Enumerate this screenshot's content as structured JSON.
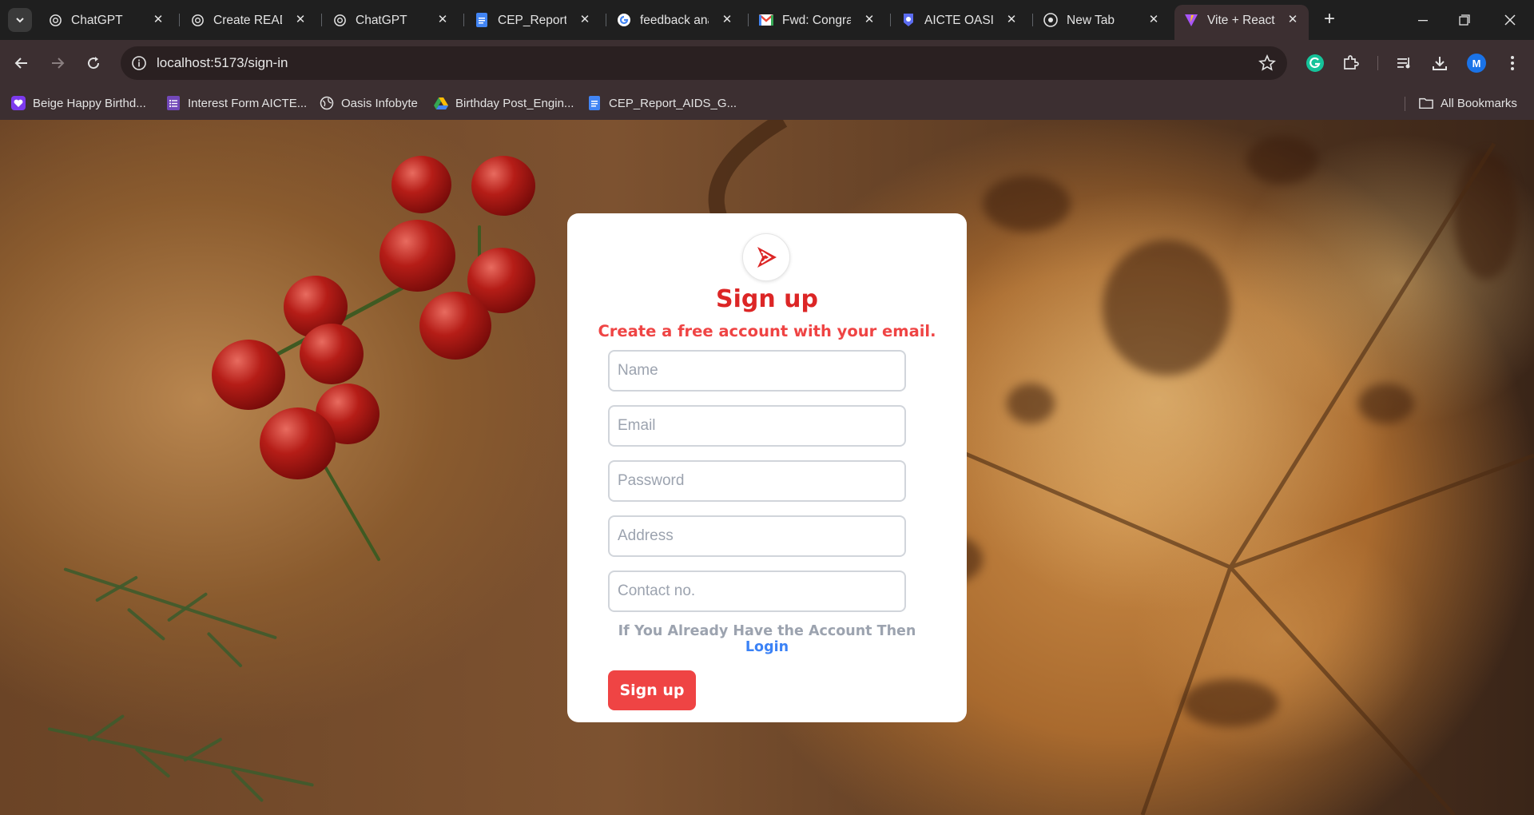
{
  "browser": {
    "tabs": [
      {
        "title": "ChatGPT",
        "icon": "chatgpt-icon"
      },
      {
        "title": "Create READ",
        "icon": "chatgpt-icon"
      },
      {
        "title": "ChatGPT",
        "icon": "chatgpt-icon"
      },
      {
        "title": "CEP_Report_/",
        "icon": "google-docs-icon"
      },
      {
        "title": "feedback ana",
        "icon": "google-icon"
      },
      {
        "title": "Fwd: Congrat",
        "icon": "gmail-icon"
      },
      {
        "title": "AICTE OASIS",
        "icon": "aicte-icon"
      },
      {
        "title": "New Tab",
        "icon": "chrome-icon"
      },
      {
        "title": "Vite + React",
        "icon": "vite-icon",
        "active": true
      }
    ],
    "url": "localhost:5173/sign-in",
    "profile_initial": "M",
    "bookmarks": [
      {
        "label": "Beige Happy Birthd...",
        "icon": "canva-heart-icon"
      },
      {
        "label": "Interest Form AICTE...",
        "icon": "google-forms-icon"
      },
      {
        "label": "Oasis Infobyte",
        "icon": "globe-icon"
      },
      {
        "label": "Birthday Post_Engin...",
        "icon": "google-drive-icon"
      },
      {
        "label": "CEP_Report_AIDS_G...",
        "icon": "google-docs-icon"
      }
    ],
    "all_bookmarks_label": "All Bookmarks"
  },
  "signup": {
    "title": "Sign up",
    "subtitle": "Create a free account with your email.",
    "fields": {
      "name_placeholder": "Name",
      "email_placeholder": "Email",
      "password_placeholder": "Password",
      "address_placeholder": "Address",
      "contact_placeholder": "Contact no."
    },
    "login_prompt": "If You Already Have the Account Then",
    "login_link": "Login",
    "submit_label": "Sign up"
  },
  "colors": {
    "brand_red": "#dc2626",
    "button_red": "#ef4444",
    "link_blue": "#3b82f6",
    "browser_frame": "#3c2f31"
  }
}
